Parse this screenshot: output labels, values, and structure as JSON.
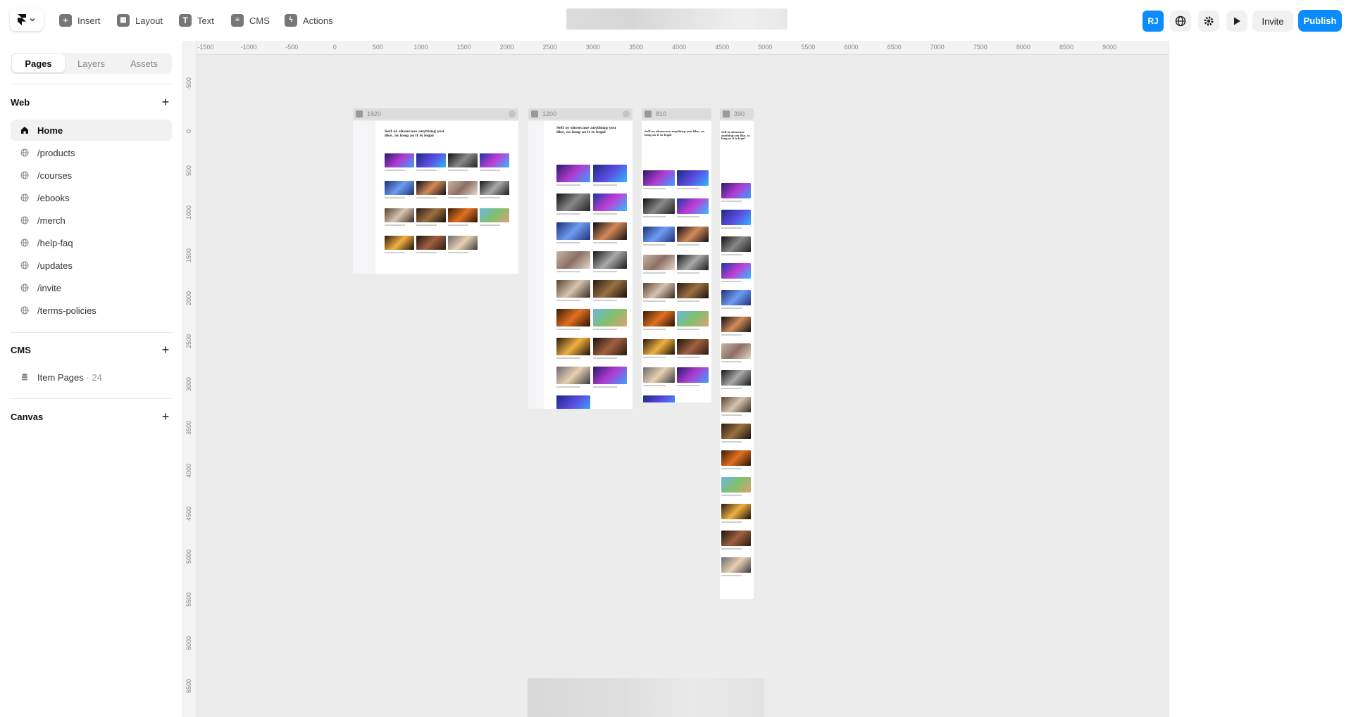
{
  "toolbar": {
    "insert_label": "Insert",
    "layout_label": "Layout",
    "text_label": "Text",
    "cms_label": "CMS",
    "actions_label": "Actions",
    "avatar_initials": "RJ",
    "invite_label": "Invite",
    "publish_label": "Publish",
    "accent_color": "#0a8cff"
  },
  "sidebar": {
    "tabs": [
      "Pages",
      "Layers",
      "Assets"
    ],
    "active_tab": "Pages",
    "web_heading": "Web",
    "pages": [
      {
        "label": "Home",
        "icon": "home-icon",
        "active": true
      },
      {
        "label": "/products",
        "icon": "globe-icon"
      },
      {
        "label": "/courses",
        "icon": "globe-icon"
      },
      {
        "label": "/ebooks",
        "icon": "globe-icon"
      },
      {
        "label": "/merch",
        "icon": "globe-icon"
      },
      {
        "label": "/help-faq",
        "icon": "globe-icon"
      },
      {
        "label": "/updates",
        "icon": "globe-icon"
      },
      {
        "label": "/invite",
        "icon": "globe-icon"
      },
      {
        "label": "/terms-policies",
        "icon": "globe-icon"
      }
    ],
    "cms_heading": "CMS",
    "cms_item_label": "Item Pages",
    "cms_item_count": "· 24",
    "canvas_heading": "Canvas"
  },
  "canvas": {
    "ruler_x": [
      "-1500",
      "-1000",
      "-500",
      "0",
      "500",
      "1000",
      "1500",
      "2000",
      "2500",
      "3000",
      "3500",
      "4000",
      "4500",
      "5000",
      "5500",
      "6000",
      "6500",
      "7000",
      "7500",
      "8000",
      "8500",
      "9000"
    ],
    "ruler_y": [
      "-500",
      "0",
      "500",
      "1000",
      "1500",
      "2000",
      "2500",
      "3000",
      "3500",
      "4000",
      "4500",
      "5000",
      "5500",
      "6000",
      "6500"
    ],
    "breakpoints": [
      {
        "label": "1920"
      },
      {
        "label": "1200"
      },
      {
        "label": "810"
      },
      {
        "label": "390"
      }
    ],
    "hero_heading": "Sell or showcase anything you like, as long as it is legal"
  }
}
